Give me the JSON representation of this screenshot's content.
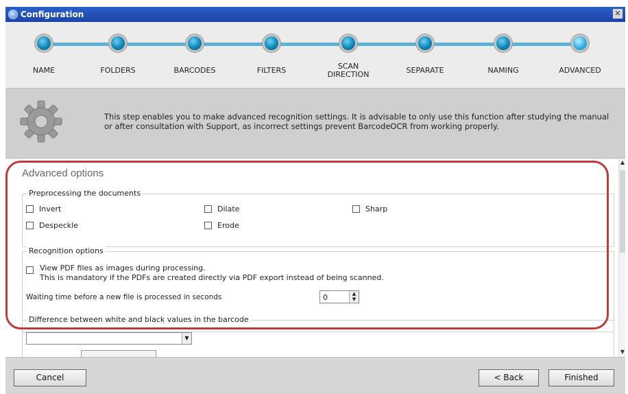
{
  "window": {
    "title": "Configuration",
    "close_glyph": "✕"
  },
  "steps": [
    {
      "label": "NAME"
    },
    {
      "label": "FOLDERS"
    },
    {
      "label": "BARCODES"
    },
    {
      "label": "FILTERS"
    },
    {
      "label": "SCAN\nDIRECTION"
    },
    {
      "label": "SEPARATE"
    },
    {
      "label": "NAMING"
    },
    {
      "label": "ADVANCED"
    }
  ],
  "info": {
    "icon": "gear-icon",
    "text": "This step enables you to make advanced recognition settings. It is advisable to only use this function after studying the manual or after consultation with Support, as incorrect settings prevent BarcodeOCR from working properly."
  },
  "advanced": {
    "title": "Advanced options",
    "preprocessing": {
      "legend": "Preprocessing the documents",
      "invert": "Invert",
      "dilate": "Dilate",
      "sharp": "Sharp",
      "despeckle": "Despeckle",
      "erode": "Erode"
    },
    "recognition": {
      "legend": "Recognition options",
      "pdf_images_line1": "View PDF files as images during processing.",
      "pdf_images_line2": "This is mandatory if the PDFs are created directly via PDF export instead of being scanned.",
      "waiting_label": "Waiting time before a new file is processed in seconds",
      "waiting_value": "0"
    },
    "difference": {
      "legend": "Difference between white and black values in the barcode",
      "selected": ""
    }
  },
  "footer": {
    "cancel": "Cancel",
    "back": "< Back",
    "finished": "Finished"
  },
  "colors": {
    "accent": "#0c86b7",
    "highlight": "#c0393b",
    "titlebar": "#2a5fc8"
  }
}
